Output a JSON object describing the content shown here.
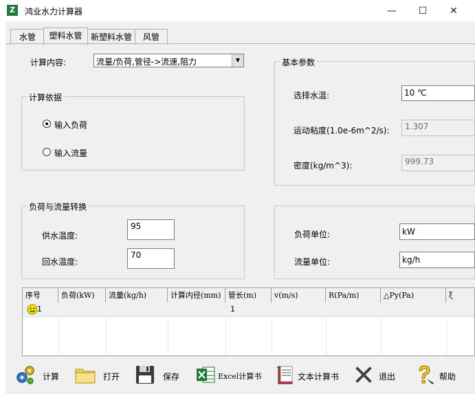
{
  "window": {
    "title": "鸿业水力计算器",
    "app_icon": "Z"
  },
  "window_controls": {
    "minimize": "—",
    "maximize": "☐",
    "close": "✕"
  },
  "tabs": [
    {
      "label": "水管"
    },
    {
      "label": "塑料水管"
    },
    {
      "label": "新塑料水管"
    },
    {
      "label": "风管"
    }
  ],
  "calc": {
    "label": "计算内容:",
    "value": "流量/负荷,管径->流速,阻力"
  },
  "basis": {
    "title": "计算依据",
    "options": [
      {
        "label": "输入负荷",
        "checked": true
      },
      {
        "label": "输入流量",
        "checked": false
      }
    ]
  },
  "params": {
    "title": "基本参数",
    "water_temp_label": "选择水温:",
    "water_temp_value": "10  ℃",
    "viscosity_label": "运动粘度(1.0e-6m^2/s):",
    "viscosity_value": "1.307",
    "density_label": "密度(kg/m^3):",
    "density_value": "999.73"
  },
  "conversion": {
    "title": "负荷与流量转换",
    "supply_label": "供水温度:",
    "supply_value": "95",
    "return_label": "回水温度:",
    "return_value": "70"
  },
  "units": {
    "load_label": "负荷单位:",
    "load_value": "kW",
    "flow_label": "流量单位:",
    "flow_value": "kg/h"
  },
  "table": {
    "columns": [
      "序号",
      "负荷(kW)",
      "流量(kg/h)",
      "计算内径(mm)",
      "管长(m)",
      "v(m/s)",
      "R(Pa/m)",
      "△Py(Pa)",
      "ξ"
    ],
    "rows": [
      {
        "index": "1",
        "length": "1"
      }
    ]
  },
  "toolbar": {
    "calculate": "计算",
    "open": "打开",
    "save": "保存",
    "excel": "Excel计算书",
    "text_report": "文本计算书",
    "exit": "退出",
    "help": "帮助"
  }
}
